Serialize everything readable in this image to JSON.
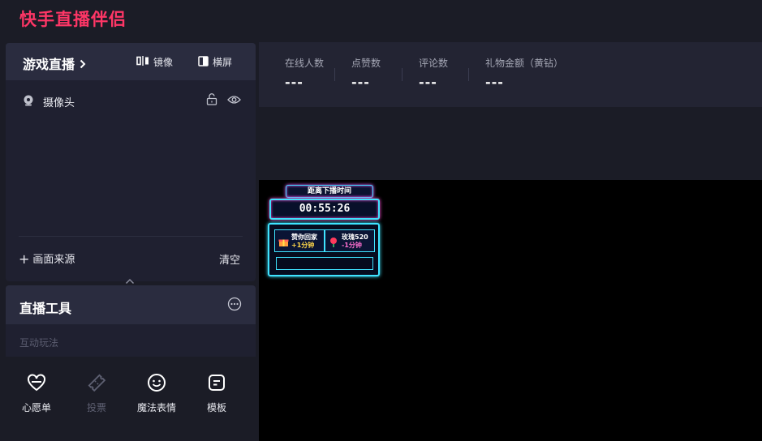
{
  "app": {
    "title": "快手直播伴侣"
  },
  "scene": {
    "title": "游戏直播",
    "mirror_label": "镜像",
    "landscape_label": "横屏",
    "sources": [
      {
        "label": "摄像头"
      }
    ],
    "add_source_label": "画面来源",
    "clear_label": "清空"
  },
  "tools": {
    "title": "直播工具",
    "section_label": "互动玩法",
    "items": [
      {
        "label": "心愿单",
        "icon": "heart-gift-icon",
        "enabled": true
      },
      {
        "label": "投票",
        "icon": "ticket-icon",
        "enabled": false
      },
      {
        "label": "魔法表情",
        "icon": "smiley-icon",
        "enabled": true
      },
      {
        "label": "模板",
        "icon": "template-icon",
        "enabled": true
      }
    ]
  },
  "stats": [
    {
      "label": "在线人数",
      "value": "---"
    },
    {
      "label": "点赞数",
      "value": "---"
    },
    {
      "label": "评论数",
      "value": "---"
    },
    {
      "label": "礼物金额（黄钻）",
      "value": "---"
    }
  ],
  "widget": {
    "tag": "距离下播时间",
    "timer": "00:55:26",
    "cells": [
      {
        "title": "赞你回家",
        "sub": "+1分钟",
        "sub_color": "#ffd84a"
      },
      {
        "title": "玫瑰520",
        "sub": "-1分钟",
        "sub_color": "#ff6fd0"
      }
    ]
  },
  "colors": {
    "accent": "#fe3666",
    "panel": "#1f2030",
    "panel_header": "#2a2c3f",
    "neon_cyan": "#3fe3ff",
    "neon_pink": "#ff4fd8"
  }
}
